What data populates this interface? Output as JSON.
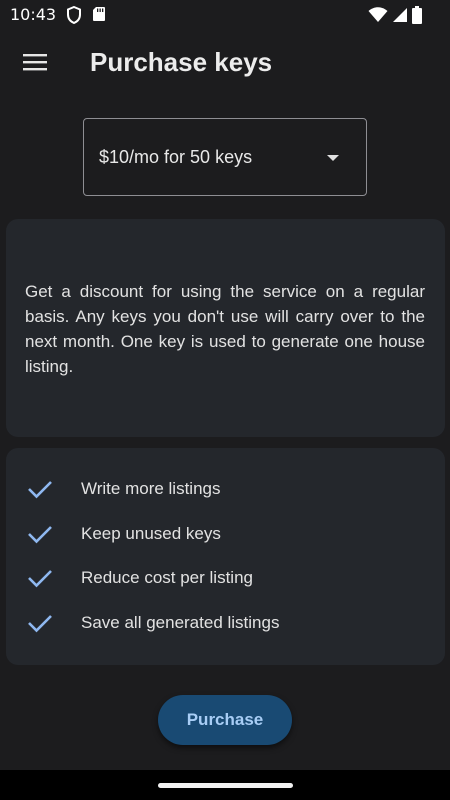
{
  "status_bar": {
    "time": "10:43",
    "icons": [
      "shield-icon",
      "sd-card-icon",
      "wifi-icon",
      "signal-icon",
      "battery-icon"
    ]
  },
  "app_bar": {
    "title": "Purchase keys",
    "menu_icon": "menu-icon"
  },
  "plan_select": {
    "value": "$10/mo for 50 keys"
  },
  "description": {
    "text": "Get a discount for using the service on a regular basis. Any keys you don't use will carry over to the next month. One key is used to generate one house listing."
  },
  "features": [
    {
      "label": "Write more listings"
    },
    {
      "label": "Keep unused keys"
    },
    {
      "label": "Reduce cost per listing"
    },
    {
      "label": "Save all generated listings"
    }
  ],
  "purchase_button": {
    "label": "Purchase"
  },
  "colors": {
    "background": "#1c1c1e",
    "card": "#24272c",
    "accent": "#a8cdf5",
    "button_bg": "#194a73",
    "check": "#8fb8f0"
  }
}
